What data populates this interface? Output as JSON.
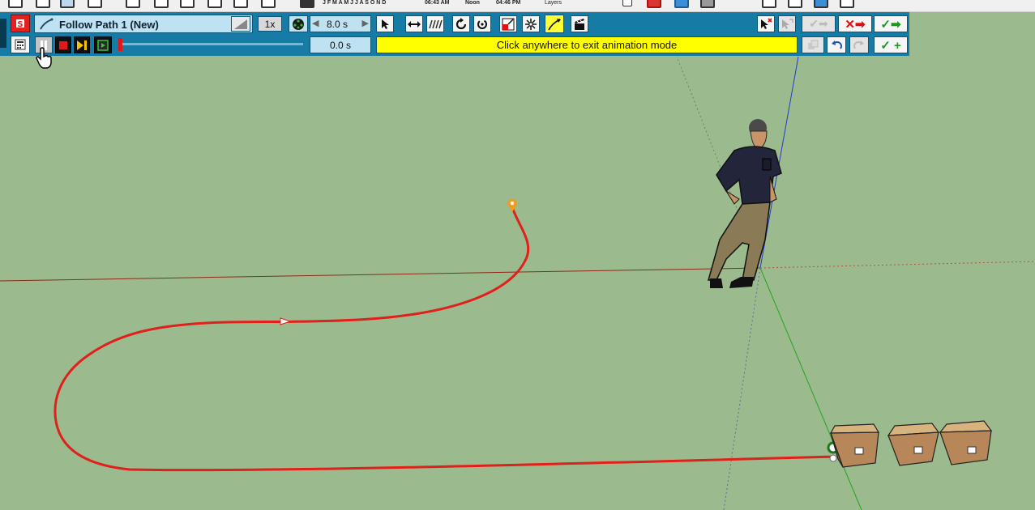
{
  "toolbar": {
    "path_name": "Follow Path 1 (New)",
    "speed": "1x",
    "duration": "8.0 s",
    "current_time": "0.0 s",
    "status_message": "Click anywhere to exit animation mode"
  },
  "top_strip": {
    "months": "J F M A M J J A S O N D",
    "time1": "06:43 AM",
    "time2": "Noon",
    "time3": "04:46 PM",
    "layers_label": "Layers"
  },
  "colors": {
    "toolbar_bg": "#167ca6",
    "status_bg": "#ffff00",
    "ground": "#9bbb8e",
    "path": "#e0201a"
  }
}
